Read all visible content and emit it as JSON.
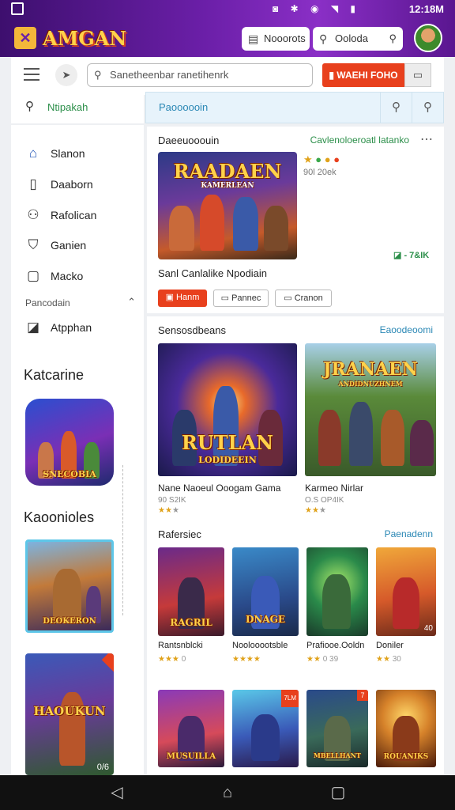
{
  "status": {
    "time": "12:18M",
    "icons": "◙ ✱ ◉ ◥ ▮"
  },
  "header": {
    "logo_text": "AMGAN",
    "pill1_label": "Nooorots",
    "pill2_label": "Ooloda"
  },
  "toolbar": {
    "search_placeholder": "Sanetheenbar ranetihenrk",
    "cta_label": "WAEHI FOHO",
    "subbar_left_label": "Ntipakah",
    "subbar_right_label": "Paoooooin"
  },
  "sidebar": {
    "items": [
      {
        "label": "Slanon",
        "icon": "home-icon"
      },
      {
        "label": "Daaborn",
        "icon": "document-icon"
      },
      {
        "label": "Rafolican",
        "icon": "group-icon"
      },
      {
        "label": "Ganien",
        "icon": "shield-icon"
      },
      {
        "label": "Macko",
        "icon": "box-icon"
      }
    ],
    "section_label": "Pancodain",
    "sub_item": "Atpphan",
    "heading1": "Katcarine",
    "heading2": "Kaoonioles",
    "thumb1_title": "SNECOBIA",
    "thumb2_title": "DEOKERON",
    "thumb3_title": "HAOUKUN",
    "thumb3_badge": "0/6"
  },
  "featured": {
    "title": "Daeeuooouin",
    "link": "Cavlenoloeroatl latanko",
    "game_title": "RAADAEN",
    "game_subtitle": "KAMERLEAN",
    "meta_line": "90l 20ek",
    "price_tag": "- 7&IK",
    "caption": "Sanl Canlalike Npodiain",
    "btn_primary": "Hanm",
    "btn2": "Pannec",
    "btn3": "Cranon"
  },
  "section2": {
    "title": "Sensosdbeans",
    "link": "Eaoodeoomi",
    "cards": [
      {
        "art_title": "RUTLAN",
        "art_sub": "LODIDEEIN",
        "name": "Nane Naoeul Ooogam Gama",
        "meta": "90 S2IK",
        "stars": 2
      },
      {
        "art_title": "JRANAEN",
        "art_sub": "ANDIDNUZHNEM",
        "name": "Karmeo Nirlar",
        "meta": "O.S OP4IK",
        "stars": 2
      }
    ]
  },
  "section3": {
    "title": "Rafersiec",
    "link": "Paenadenn",
    "cards": [
      {
        "art_title": "RAGRIL",
        "name": "Rantsnblcki",
        "stars": 3,
        "meta": "0"
      },
      {
        "art_title": "DNAGE",
        "name": "Noolooootsble",
        "stars": 4,
        "meta": ""
      },
      {
        "art_title": "",
        "name": "Prafiooe.Ooldn",
        "stars": 2,
        "meta": "0 39"
      },
      {
        "art_title": "",
        "name": "Doniler",
        "stars": 2,
        "meta": "30",
        "badge": "40"
      }
    ],
    "row2": [
      {
        "art_title": "MUSUILLA",
        "badge": ""
      },
      {
        "art_title": "",
        "badge": "7LM"
      },
      {
        "art_title": "MBELLHANT",
        "badge": "7"
      },
      {
        "art_title": "ROUANIKS",
        "badge": ""
      }
    ]
  },
  "colors": {
    "accent": "#e8401d",
    "header": "#6b1fa8",
    "link": "#2b88b5",
    "green": "#2c8f4a"
  }
}
